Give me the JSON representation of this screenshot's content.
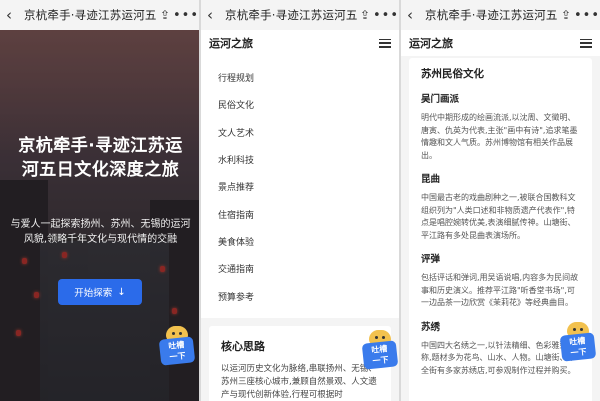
{
  "screens": [
    {
      "topbar": {
        "back": "‹",
        "title": "京杭牵手·寻迹江苏运河五...",
        "share": "⇪",
        "more": "•••"
      },
      "hero": {
        "title": "京杭牵手·寻迹江苏运河五日文化深度之旅",
        "subtitle": "与爱人一起探索扬州、苏州、无锡的运河风貌,领略千年文化与现代情的交融",
        "cta_label": "开始探索",
        "cta_icon": "↓"
      },
      "mascot": {
        "line1": "吐槽",
        "line2": "一下"
      }
    },
    {
      "topbar": {
        "back": "‹",
        "title": "京杭牵手·寻迹江苏运河五...",
        "share": "⇪",
        "more": "•••"
      },
      "nav": {
        "brand": "运河之旅",
        "menu_icon": "hamburger-icon"
      },
      "menu": [
        "行程规划",
        "民俗文化",
        "文人艺术",
        "水利科技",
        "景点推荐",
        "住宿指南",
        "美食体验",
        "交通指南",
        "预算参考"
      ],
      "card": {
        "title": "核心思路",
        "body": "以运河历史文化为脉络,串联扬州、无锡、苏州三座核心城市,兼顾自然景观、人文遗产与现代创新体验,行程可根据时"
      },
      "mascot": {
        "line1": "吐槽",
        "line2": "一下"
      }
    },
    {
      "topbar": {
        "back": "‹",
        "title": "京杭牵手·寻迹江苏运河五...",
        "share": "⇪",
        "more": "•••"
      },
      "nav": {
        "brand": "运河之旅",
        "menu_icon": "hamburger-icon"
      },
      "content": {
        "heading": "苏州民俗文化",
        "sections": [
          {
            "title": "吴门画派",
            "body": "明代中期形成的绘画流派,以沈周、文徵明、唐寅、仇英为代表,主张\"画中有诗\",追求笔墨情趣和文人气质。苏州博物馆有相关作品展出。"
          },
          {
            "title": "昆曲",
            "body": "中国最古老的戏曲剧种之一,被联合国教科文组织列为\"人类口述和非物质遗产代表作\",特点是唱腔婉转优美,表演细腻传神。山塘街、平江路有多处昆曲表演场所。"
          },
          {
            "title": "评弹",
            "body": "包括评话和弹词,用吴语说唱,内容多为民间故事和历史演义。推荐平江路\"听香堂书场\",可一边品茶一边欣赏《茉莉花》等经典曲目。"
          },
          {
            "title": "苏绣",
            "body": "中国四大名绣之一,以针法精细、色彩雅致著称,题材多为花鸟、山水、人物。山塘街、十全街有多家苏绣店,可参观制作过程并购买。"
          }
        ]
      },
      "mascot": {
        "line1": "吐槽",
        "line2": "一下"
      }
    }
  ],
  "colors": {
    "accent": "#2b6bea",
    "mascot_sign": "#3a7bec",
    "mascot_head": "#f2c14e",
    "lantern": "#c8322a"
  }
}
